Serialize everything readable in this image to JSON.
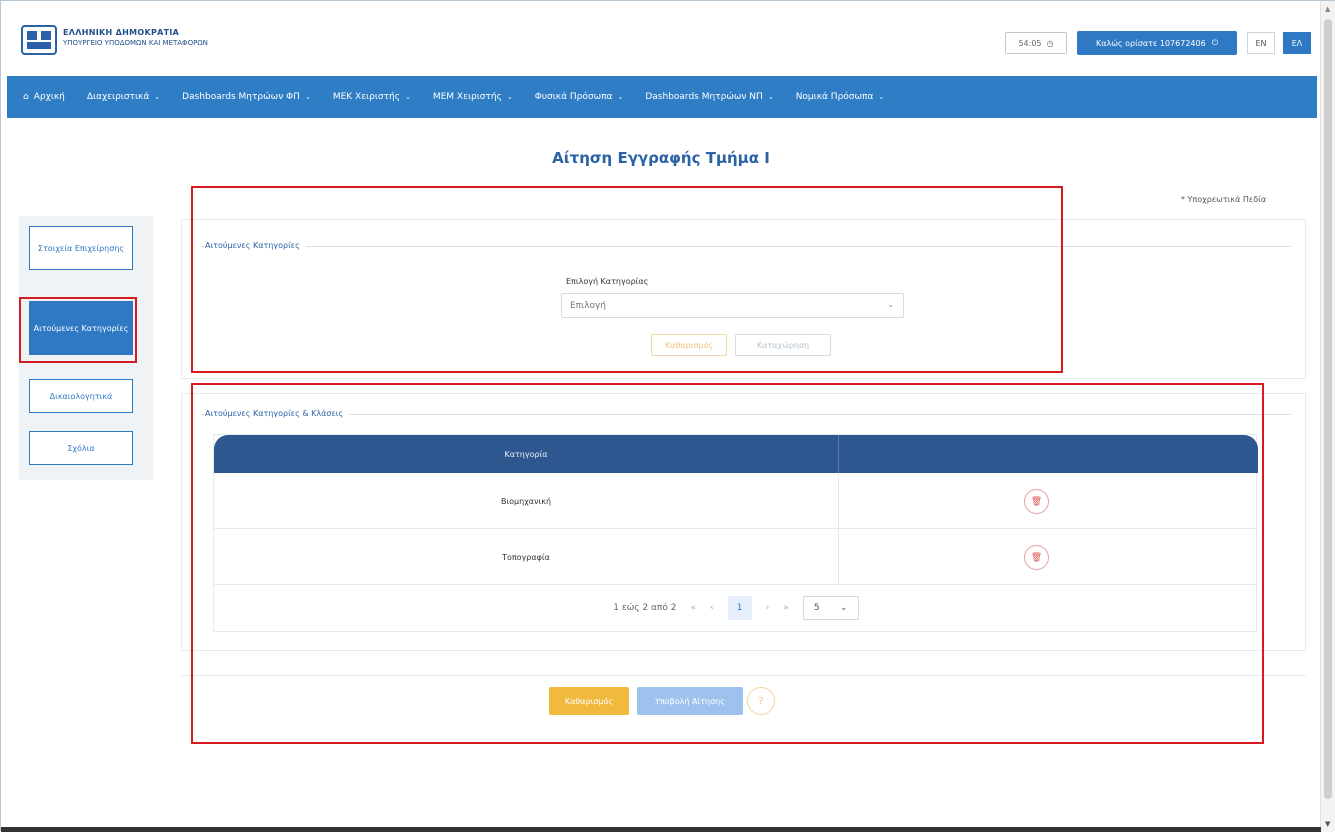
{
  "header": {
    "brand_line1": "ΕΛΛΗΝΙΚΗ ΔΗΜΟΚΡΑΤΙΑ",
    "brand_line2": "ΥΠΟΥΡΓΕΙΟ ΥΠΟΔΟΜΩΝ ΚΑΙ ΜΕΤΑΦΟΡΩΝ",
    "timer": "54:05",
    "welcome": "Καλώς ορίσατε 107672406",
    "lang_en": "EN",
    "lang_el": "ΕΛ"
  },
  "nav": {
    "items": [
      {
        "label": "Αρχική",
        "icon": "home-icon"
      },
      {
        "label": "Διαχειριστικά"
      },
      {
        "label": "Dashboards Μητρώων ΦΠ"
      },
      {
        "label": "ΜΕΚ Χειριστής"
      },
      {
        "label": "ΜΕΜ Χειριστής"
      },
      {
        "label": "Φυσικά Πρόσωπα"
      },
      {
        "label": "Dashboards Μητρώων ΝΠ"
      },
      {
        "label": "Νομικά Πρόσωπα"
      }
    ]
  },
  "page": {
    "title": "Αίτηση Εγγραφής Τμήμα Ι",
    "required": "* Υποχρεωτικά Πεδία"
  },
  "side_menu": {
    "items": [
      "Στοιχεία Επιχείρησης",
      "Αιτούμενες Κατηγορίες",
      "Δικαιολογητικά",
      "Σχόλια"
    ]
  },
  "section1": {
    "legend": "Αιτούμενες Κατηγορίες",
    "field_label": "Επιλογή Κατηγορίας",
    "select_value": "Επιλογή",
    "btn_clear": "Καθαρισμός",
    "btn_register": "Καταχώρηση"
  },
  "section2": {
    "legend": "Αιτούμενες Κατηγορίες & Κλάσεις",
    "table": {
      "header": "Κατηγορία",
      "rows": [
        "Βιομηχανική",
        "Τοπογραφία"
      ]
    },
    "pager": {
      "summary": "1 εώς 2 από 2",
      "first": "«",
      "prev": "‹",
      "current": "1",
      "next": "›",
      "last": "»",
      "size": "5"
    }
  },
  "actions": {
    "clear": "Καθαρισμός",
    "submit": "Υποβολή Αίτησης",
    "help": "?"
  },
  "colors": {
    "primary": "#2f78c4",
    "nav": "#2f7dc4",
    "table_header": "#2d578e",
    "highlight": "#d71920",
    "warning": "#f1b93d"
  }
}
